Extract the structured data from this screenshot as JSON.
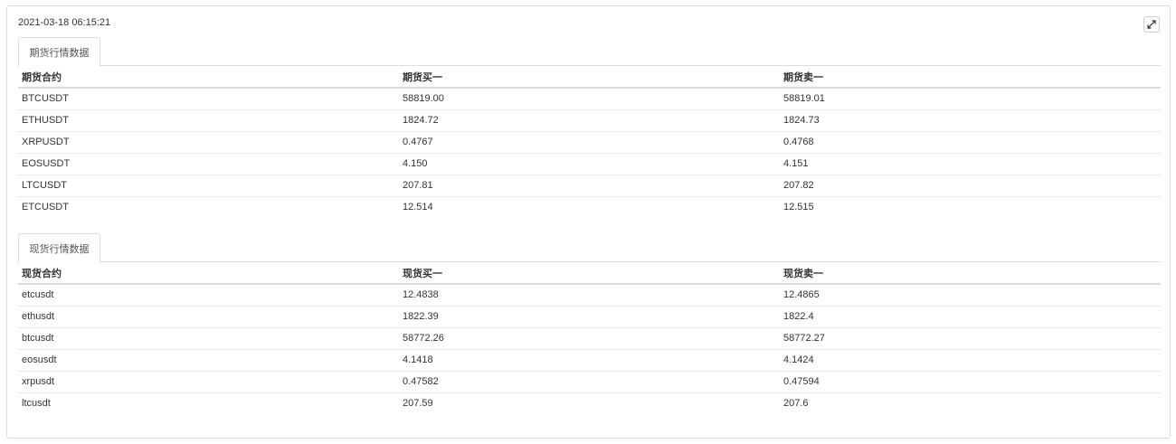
{
  "header": {
    "timestamp": "2021-03-18 06:15:21",
    "expand_icon": "expand-arrows-icon"
  },
  "futures": {
    "tab_label": "期货行情数据",
    "columns": [
      "期货合约",
      "期货买一",
      "期货卖一"
    ],
    "rows": [
      [
        "BTCUSDT",
        "58819.00",
        "58819.01"
      ],
      [
        "ETHUSDT",
        "1824.72",
        "1824.73"
      ],
      [
        "XRPUSDT",
        "0.4767",
        "0.4768"
      ],
      [
        "EOSUSDT",
        "4.150",
        "4.151"
      ],
      [
        "LTCUSDT",
        "207.81",
        "207.82"
      ],
      [
        "ETCUSDT",
        "12.514",
        "12.515"
      ]
    ]
  },
  "spot": {
    "tab_label": "现货行情数据",
    "columns": [
      "现货合约",
      "现货买一",
      "现货卖一"
    ],
    "rows": [
      [
        "etcusdt",
        "12.4838",
        "12.4865"
      ],
      [
        "ethusdt",
        "1822.39",
        "1822.4"
      ],
      [
        "btcusdt",
        "58772.26",
        "58772.27"
      ],
      [
        "eosusdt",
        "4.1418",
        "4.1424"
      ],
      [
        "xrpusdt",
        "0.47582",
        "0.47594"
      ],
      [
        "ltcusdt",
        "207.59",
        "207.6"
      ]
    ]
  }
}
